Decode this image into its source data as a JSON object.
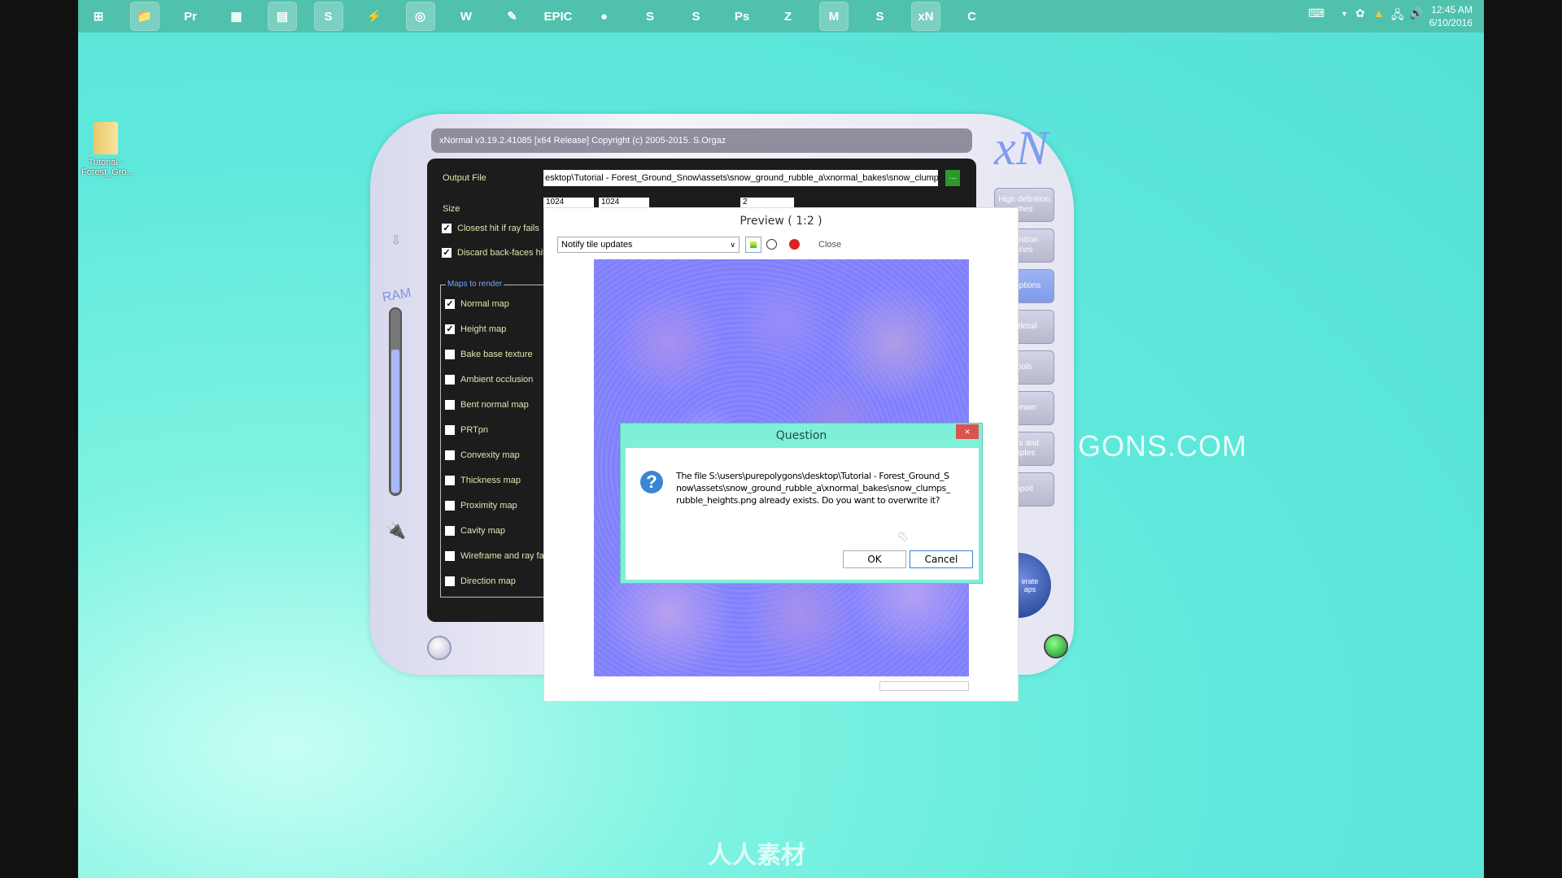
{
  "taskbar": {
    "icons": [
      {
        "name": "windows-start",
        "label": "⊞"
      },
      {
        "name": "file-explorer",
        "label": "📁"
      },
      {
        "name": "premiere-pro",
        "label": "Pr"
      },
      {
        "name": "calculator",
        "label": "▦"
      },
      {
        "name": "steam-like",
        "label": "▤"
      },
      {
        "name": "skype",
        "label": "S"
      },
      {
        "name": "download-manager",
        "label": "⚡"
      },
      {
        "name": "chrome",
        "label": "◎"
      },
      {
        "name": "word",
        "label": "W"
      },
      {
        "name": "paint-tool",
        "label": "✎"
      },
      {
        "name": "epic-games",
        "label": "EPIC"
      },
      {
        "name": "app-2",
        "label": "●"
      },
      {
        "name": "substance-designer",
        "label": "S"
      },
      {
        "name": "substance-painter",
        "label": "S"
      },
      {
        "name": "photoshop",
        "label": "Ps"
      },
      {
        "name": "zbrush",
        "label": "Z"
      },
      {
        "name": "maya",
        "label": "M"
      },
      {
        "name": "app-s",
        "label": "S"
      },
      {
        "name": "xnormal",
        "label": "xN"
      },
      {
        "name": "app-c",
        "label": "C"
      }
    ],
    "clock_time": "12:45 AM",
    "clock_date": "6/10/2016"
  },
  "desktop": {
    "icon_label": "Tutorial - Forest_Gro...",
    "watermark": "GONS.COM",
    "bottom_watermark": "人人素材"
  },
  "xnormal": {
    "title": "xNormal v3.19.2.41085 [x64 Release] Copyright (c) 2005-2015. S.Orgaz",
    "logo": "xN",
    "output_file_label": "Output File",
    "output_file_value": "esktop\\Tutorial - Forest_Ground_Snow\\assets\\snow_ground_rubble_a\\xnormal_bakes\\snow_clumps_rubble.png",
    "browse_label": "...",
    "size_label": "Size",
    "size_w": "1024",
    "size_h": "1024",
    "edge_value": "2",
    "options": [
      {
        "label": "Closest hit if ray fails",
        "checked": true
      },
      {
        "label": "Discard back-faces hits",
        "checked": true
      }
    ],
    "maps_group": "Maps to render",
    "maps": [
      {
        "label": "Normal map",
        "checked": true
      },
      {
        "label": "Height map",
        "checked": true
      },
      {
        "label": "Bake base texture",
        "checked": false
      },
      {
        "label": "Ambient occlusion",
        "checked": false
      },
      {
        "label": "Bent normal map",
        "checked": false
      },
      {
        "label": "PRTpn",
        "checked": false
      },
      {
        "label": "Convexity map",
        "checked": false
      },
      {
        "label": "Thickness map",
        "checked": false
      },
      {
        "label": "Proximity map",
        "checked": false
      },
      {
        "label": "Cavity map",
        "checked": false
      },
      {
        "label": "Wireframe and ray fails",
        "checked": false
      },
      {
        "label": "Direction map",
        "checked": false
      }
    ],
    "ram_label": "RAM",
    "ram_usage_fraction": 0.76,
    "side_buttons": [
      "High definition\nshes",
      "efinition\nshes",
      "g options",
      "e detail",
      "ools",
      "Viewer",
      "ngs and\nmples",
      "ppoit"
    ],
    "selected_side_button": 2,
    "generate_label": "erate\naps"
  },
  "preview": {
    "title": "Preview ( 1:2 )",
    "dropdown_value": "Notify tile updates",
    "close_label": "Close"
  },
  "dialog": {
    "title": "Question",
    "message": "The file S:\\users\\purepolygons\\desktop\\Tutorial - Forest_Ground_Snow\\assets\\snow_ground_rubble_a\\xnormal_bakes\\snow_clumps_rubble_heights.png already exists. Do you want to overwrite it?",
    "ok_label": "OK",
    "cancel_label": "Cancel",
    "close_glyph": "×",
    "icon": "question-icon"
  },
  "colors": {
    "taskbar": "#4fc1ad",
    "desktop": "#5fe9dc",
    "dialog_border": "#7ff0d8",
    "accent_green": "#2a9a2a"
  }
}
